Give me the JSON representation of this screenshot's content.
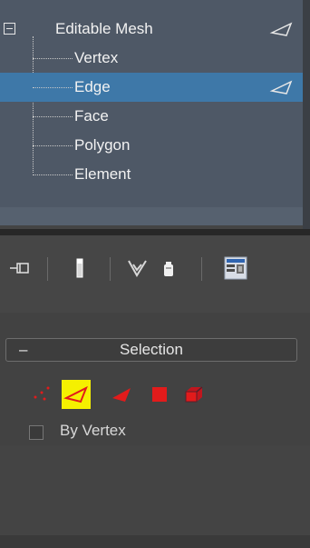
{
  "stack": {
    "root_label": "Editable Mesh",
    "items": [
      {
        "label": "Vertex",
        "selected": false
      },
      {
        "label": "Edge",
        "selected": true
      },
      {
        "label": "Face",
        "selected": false
      },
      {
        "label": "Polygon",
        "selected": false
      },
      {
        "label": "Element",
        "selected": false
      }
    ]
  },
  "toolbar": {
    "buttons": [
      "pin-stack-icon",
      "show-end-result-icon",
      "make-unique-icon",
      "remove-modifier-icon",
      "configure-modifier-sets-icon"
    ]
  },
  "selection_rollout": {
    "title": "Selection",
    "collapse_symbol": "–",
    "subobject_buttons": [
      "vertex-icon",
      "edge-icon",
      "face-icon",
      "polygon-icon",
      "element-icon"
    ],
    "active": "edge-icon",
    "checkbox_label": "By Vertex"
  },
  "colors": {
    "tree_bg": "#4e5866",
    "selected_row": "#3e78a8",
    "active_button": "#f5f000",
    "subobject_red": "#e21b1b"
  }
}
